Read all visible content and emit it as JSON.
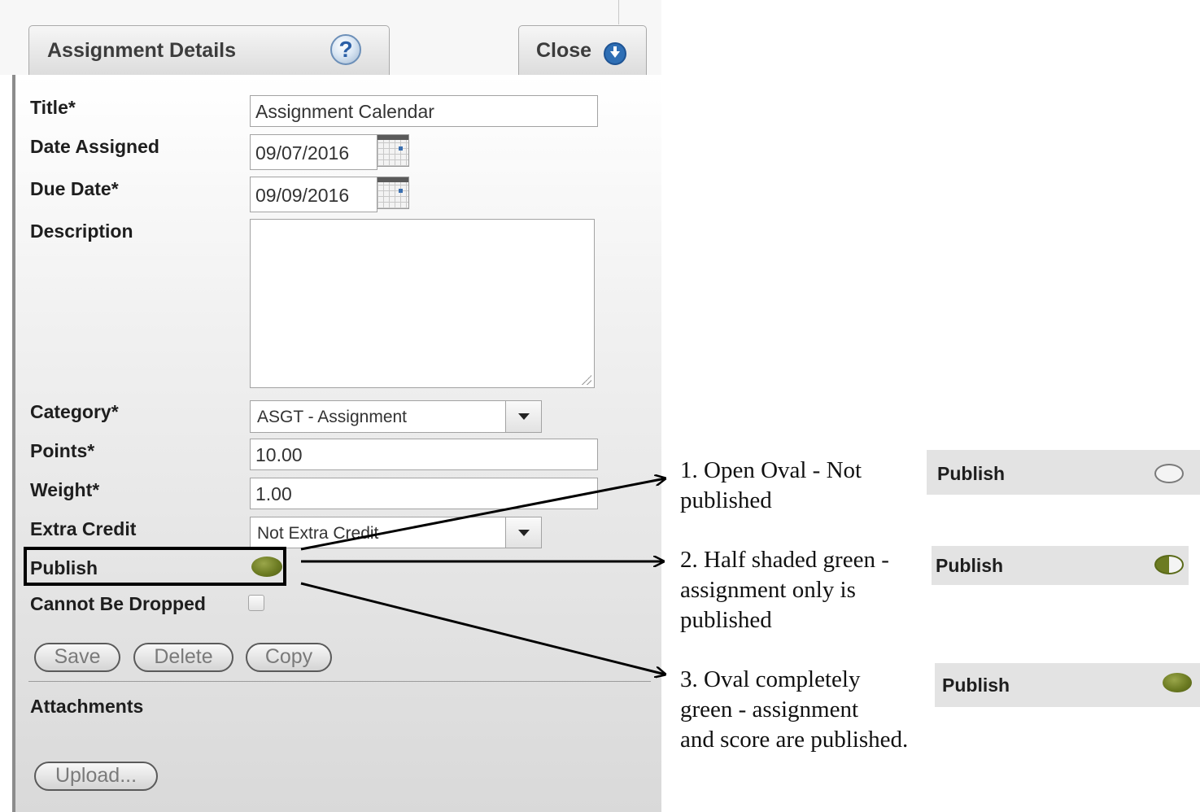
{
  "dialog": {
    "tab_title": "Assignment Details",
    "close_label": "Close",
    "help_glyph": "?",
    "fields": {
      "title_label": "Title*",
      "title_value": "Assignment Calendar",
      "date_assigned_label": "Date Assigned",
      "date_assigned_value": "09/07/2016",
      "due_date_label": "Due Date*",
      "due_date_value": "09/09/2016",
      "description_label": "Description",
      "description_value": "",
      "category_label": "Category*",
      "category_value": "ASGT - Assignment",
      "points_label": "Points*",
      "points_value": "10.00",
      "weight_label": "Weight*",
      "weight_value": "1.00",
      "extra_credit_label": "Extra Credit",
      "extra_credit_value": "Not Extra Credit",
      "publish_label": "Publish",
      "cannot_be_dropped_label": "Cannot Be Dropped"
    },
    "buttons": {
      "save": "Save",
      "delete": "Delete",
      "copy": "Copy",
      "upload": "Upload..."
    },
    "attachments_label": "Attachments"
  },
  "annotations": [
    {
      "lines": [
        "1. Open Oval - Not",
        "published"
      ],
      "state": "open",
      "label": "Publish"
    },
    {
      "lines": [
        "2. Half shaded green -",
        "assignment only is",
        "published"
      ],
      "state": "half",
      "label": "Publish"
    },
    {
      "lines": [
        "3. Oval completely",
        "green - assignment",
        "and score are published."
      ],
      "state": "full",
      "label": "Publish"
    }
  ],
  "colors": {
    "publish_green": "#6c7b22",
    "panel_gray": "#e3e3e3",
    "help_blue": "#2b5fa6"
  },
  "icons": [
    "help-icon",
    "close-icon",
    "calendar-icon",
    "dropdown-arrow-icon",
    "publish-oval-icon"
  ]
}
